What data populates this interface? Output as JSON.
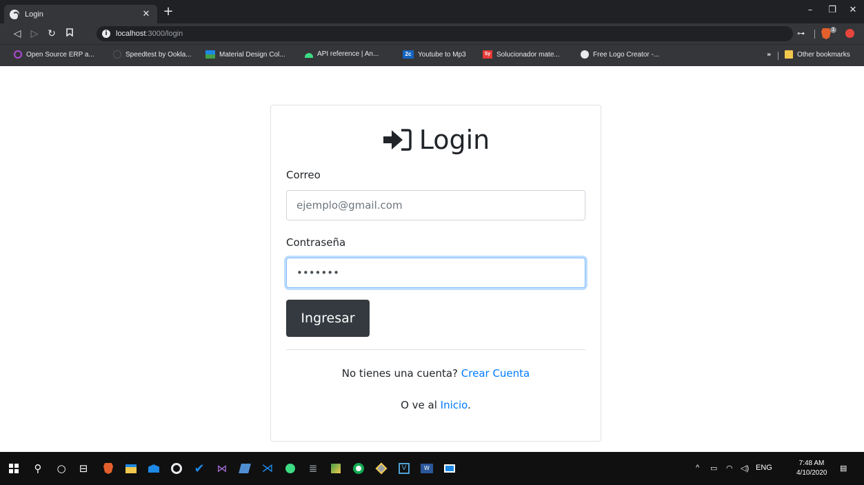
{
  "browser": {
    "tab_title": "Login",
    "new_tab": "+",
    "url_host": "localhost",
    "url_path": ":3000/login",
    "window_min": "–",
    "window_restore": "❐",
    "window_close": "✕",
    "extension_badge": "1",
    "bookmarks": [
      {
        "label": "Open Source ERP a...",
        "icon_color": "#b04ad6"
      },
      {
        "label": "Speedtest by Ookla...",
        "icon_color": "#3a3b3e"
      },
      {
        "label": "Material Design Col...",
        "icon_color": "#1e88e5"
      },
      {
        "label": "API reference | An...",
        "icon_color": "#3ddc84"
      },
      {
        "label": "Youtube to Mp3",
        "icon_color": "#1565c0",
        "icon_text": "2c"
      },
      {
        "label": "Solucionador mate...",
        "icon_color": "#e53935",
        "icon_text": "Sy"
      },
      {
        "label": "Free Logo Creator -...",
        "icon_color": "#e8eaed"
      }
    ],
    "bookmarks_more": "»",
    "other_bookmarks": "Other bookmarks"
  },
  "login": {
    "title": "Login",
    "email_label": "Correo",
    "email_placeholder": "ejemplo@gmail.com",
    "password_label": "Contraseña",
    "password_value": "1234567",
    "submit": "Ingresar",
    "no_account_text": "No tienes una cuenta? ",
    "create_account_link": "Crear Cuenta",
    "home_prefix": "O ve al ",
    "home_link": "Inicio",
    "home_suffix": "."
  },
  "taskbar": {
    "lang": "ENG",
    "time": "7:48 AM",
    "date": "4/10/2020"
  },
  "colors": {
    "accent": "#007bff",
    "button": "#343a40",
    "focus": "#80bdff"
  }
}
